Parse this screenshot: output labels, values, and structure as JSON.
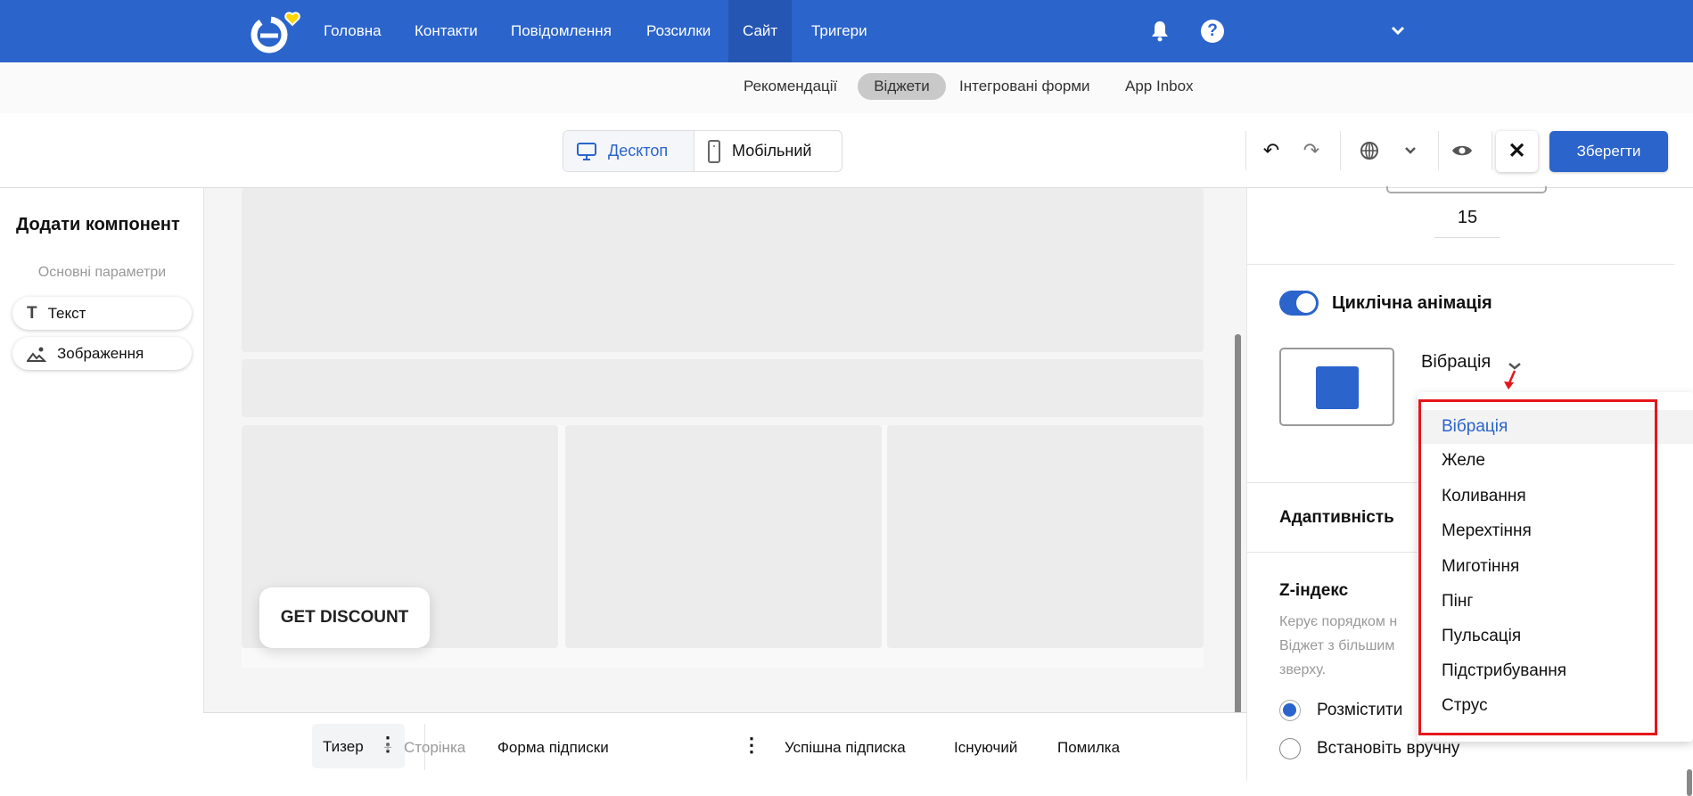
{
  "header": {
    "nav": [
      "Головна",
      "Контакти",
      "Повідомлення",
      "Розсилки",
      "Сайт",
      "Тригери"
    ],
    "active": "Сайт",
    "colors": {
      "brand": "#2b64cb",
      "active": "#2656b4"
    }
  },
  "subnav": {
    "items": [
      "Рекомендації",
      "Віджети",
      "Інтегровані форми",
      "App Inbox"
    ],
    "active": "Віджети"
  },
  "toolbar": {
    "desktop": "Десктоп",
    "mobile": "Мобільний",
    "save": "Зберегти"
  },
  "left": {
    "title": "Додати компонент",
    "section": "Основні параметри",
    "items": [
      "Текст",
      "Зображення"
    ]
  },
  "canvas": {
    "cta": "GET DISCOUNT"
  },
  "bottom": {
    "tabs": [
      "Тизер",
      "Сторінка",
      "Форма підписки",
      "Успішна підписка",
      "Існуючий",
      "Помилка"
    ],
    "add_symbol": "+"
  },
  "right": {
    "value": "15",
    "cyclic_label": "Циклічна анімація",
    "cyclic_on": true,
    "selected": "Вібрація",
    "adaptive": "Адаптивність",
    "z_title": "Z-індекс",
    "z_desc": [
      "Керує порядком н",
      "Віджет з більшим",
      "зверху."
    ],
    "radios": [
      "Розмістити",
      "Встановіть вручну"
    ],
    "radio_selected": 0
  },
  "dropdown": {
    "options": [
      "Вібрація",
      "Желе",
      "Коливання",
      "Мерехтіння",
      "Миготіння",
      "Пінг",
      "Пульсація",
      "Підстрибування",
      "Струс"
    ],
    "highlighted": "Вібрація"
  }
}
